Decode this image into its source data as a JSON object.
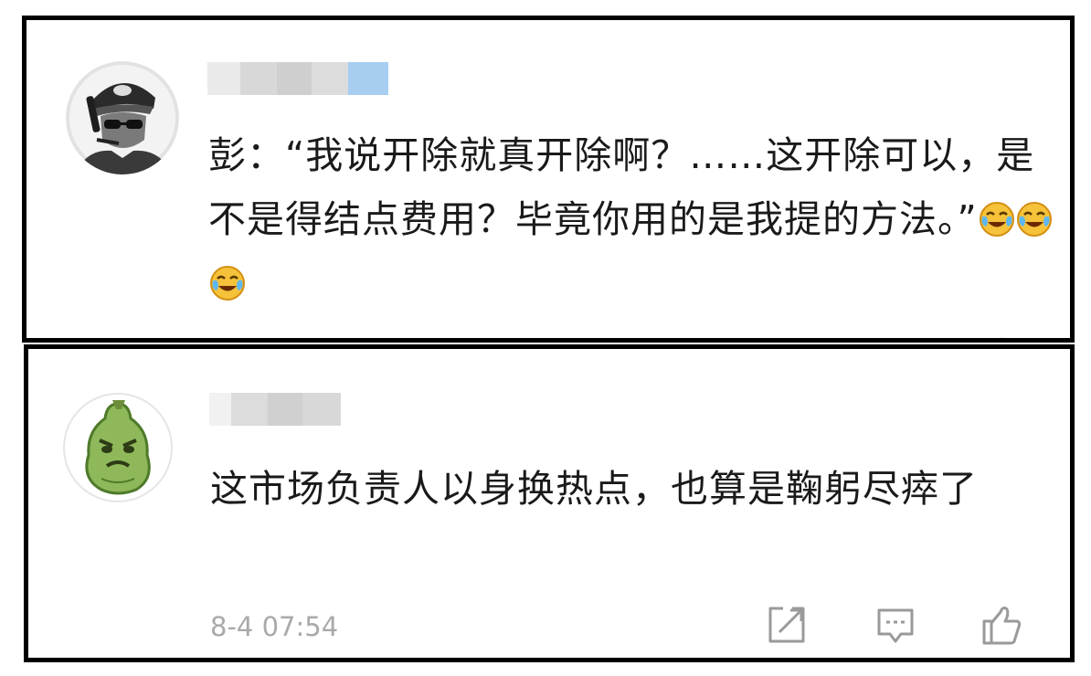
{
  "comments": [
    {
      "username_obscured": true,
      "text": "彭：“我说开除就真开除啊？……这开除可以，是不是得结点费用？毕竟你用的是我提的方法。”",
      "emojis": [
        "crying-laughing-emoji",
        "crying-laughing-emoji",
        "crying-laughing-emoji"
      ]
    },
    {
      "username_obscured": true,
      "text": "这市场负责人以身换热点，也算是鞠躬尽瘁了",
      "timestamp": "8-4 07:54",
      "actions": [
        "share-icon",
        "comment-icon",
        "thumbs-up-icon"
      ]
    }
  ],
  "colors": {
    "frame_border": "#000000",
    "comment_text": "#1a1a1a",
    "meta_text": "#a9a9a9",
    "icon_stroke": "#9a9a9a",
    "blur_blue": "#a7cdf1"
  }
}
